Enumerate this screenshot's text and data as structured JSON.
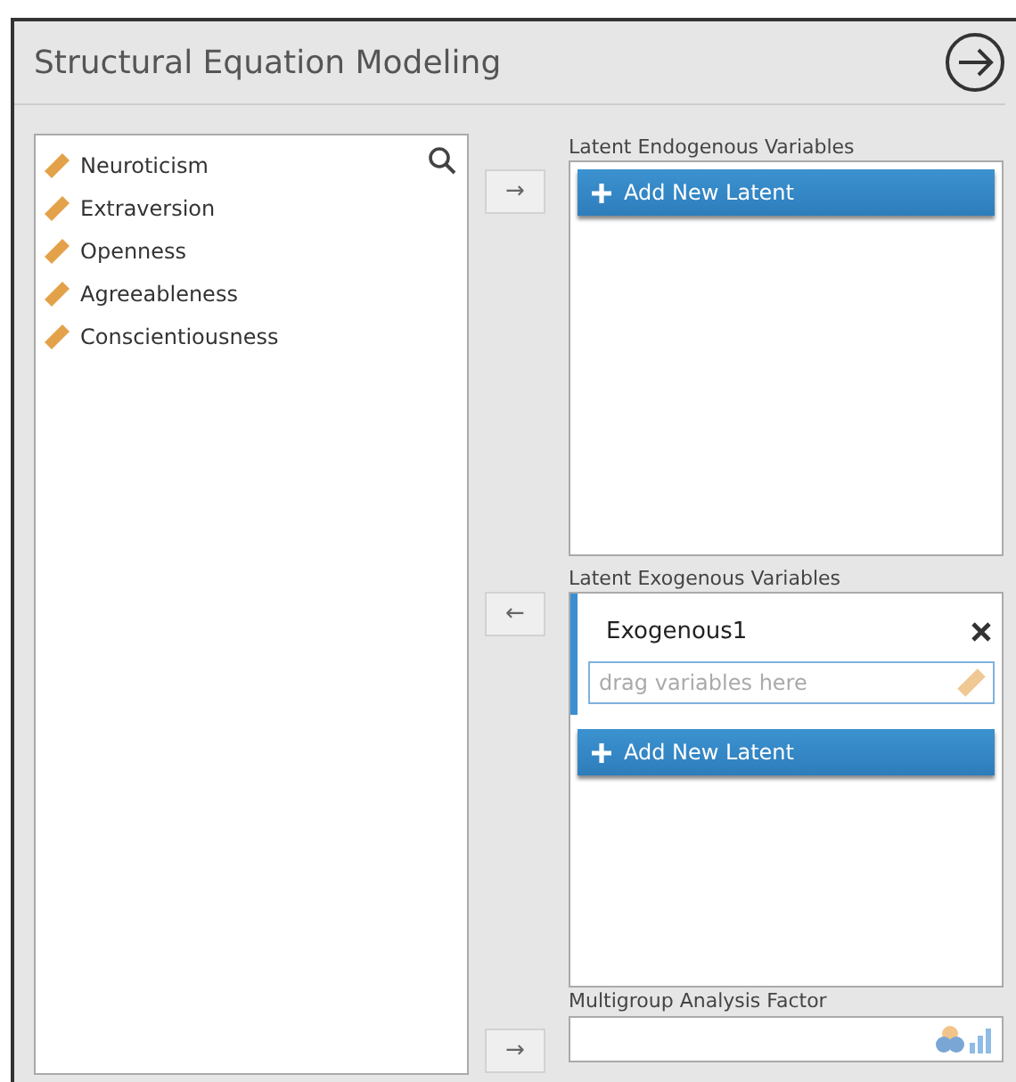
{
  "window": {
    "title": "Structural Equation Modeling"
  },
  "variables": [
    {
      "name": "Neuroticism"
    },
    {
      "name": "Extraversion"
    },
    {
      "name": "Openness"
    },
    {
      "name": "Agreeableness"
    },
    {
      "name": "Conscientiousness"
    }
  ],
  "endogenous": {
    "arrow": "→",
    "label": "Latent Endogenous Variables",
    "add_button": "Add New Latent"
  },
  "exogenous": {
    "arrow": "←",
    "label": "Latent Exogenous Variables",
    "latents": [
      {
        "name": "Exogenous1",
        "placeholder": "drag variables here"
      }
    ],
    "add_button": "Add New Latent"
  },
  "multigroup": {
    "arrow": "→",
    "label": "Multigroup Analysis Factor"
  }
}
